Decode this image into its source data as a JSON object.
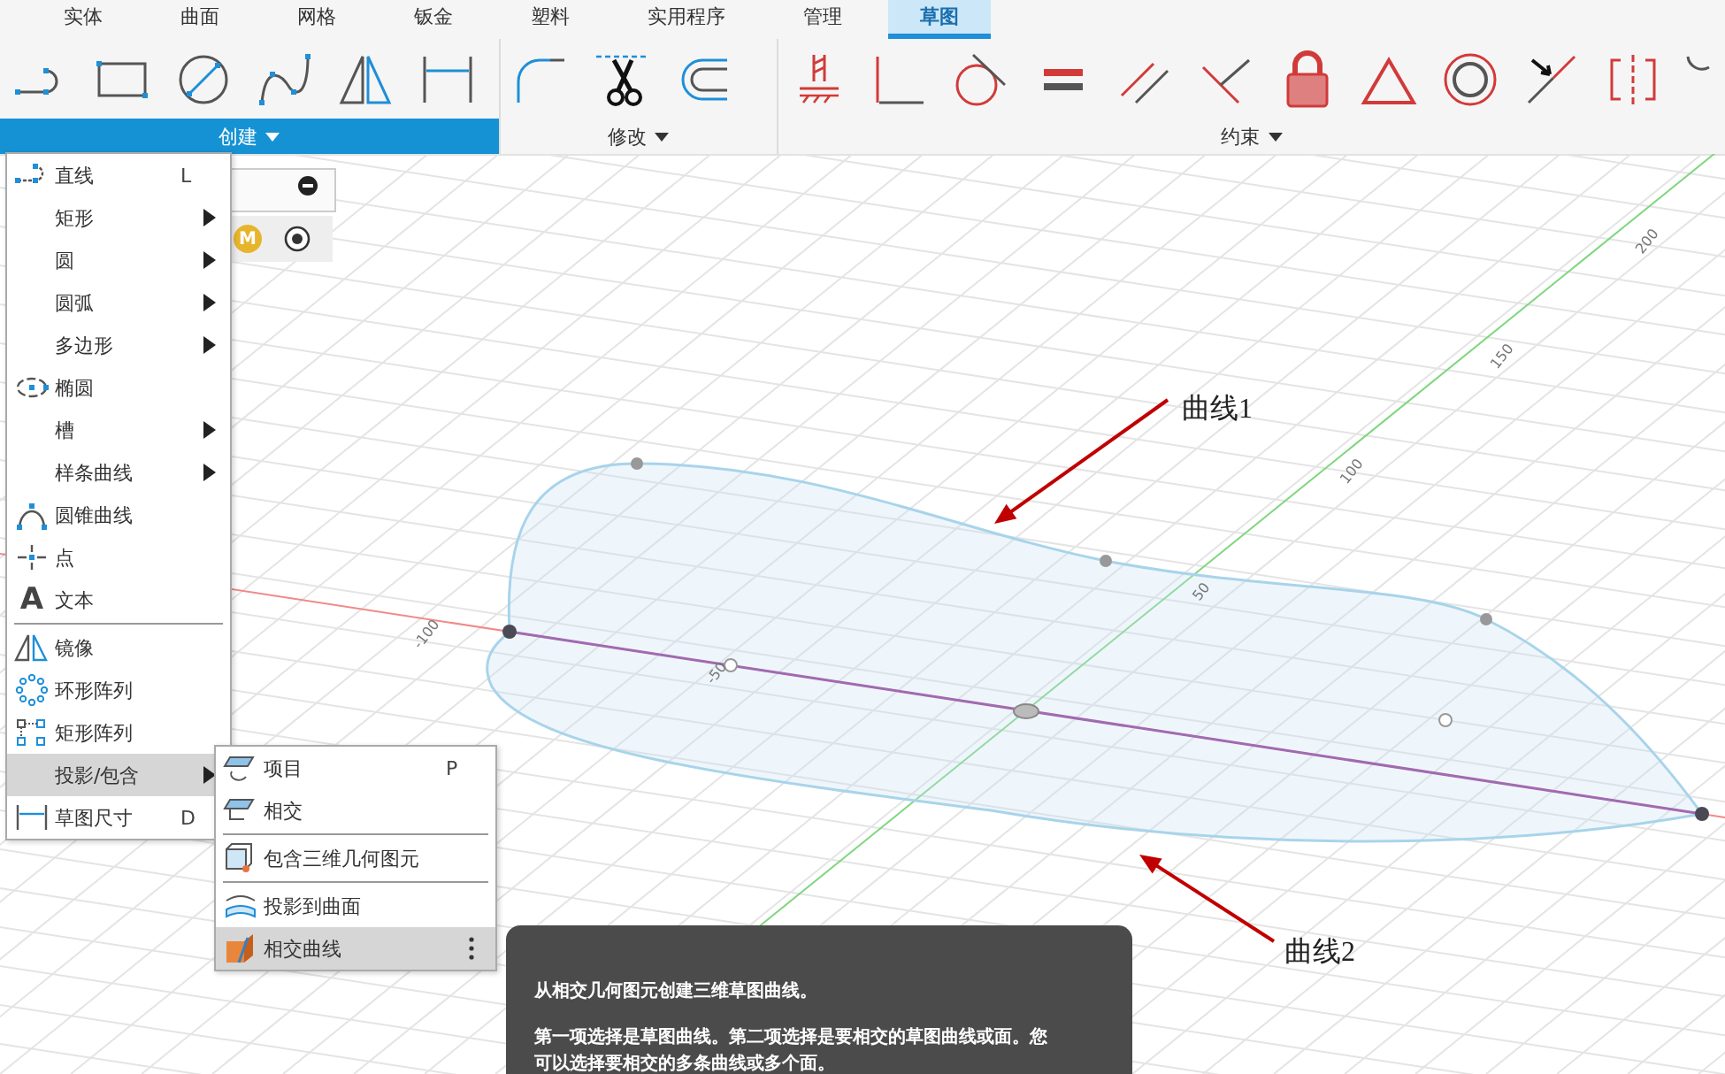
{
  "tabs": [
    {
      "label": "实体",
      "selected": false
    },
    {
      "label": "曲面",
      "selected": false
    },
    {
      "label": "网格",
      "selected": false
    },
    {
      "label": "钣金",
      "selected": false
    },
    {
      "label": "塑料",
      "selected": false
    },
    {
      "label": "实用程序",
      "selected": false
    },
    {
      "label": "管理",
      "selected": false
    },
    {
      "label": "草图",
      "selected": true
    }
  ],
  "ribbon_groups": [
    {
      "label": "创建",
      "selected": true
    },
    {
      "label": "修改",
      "selected": false
    },
    {
      "label": "约束",
      "selected": false
    }
  ],
  "hidden_panel": {
    "badge": "M"
  },
  "create_menu": {
    "sections": [
      [
        {
          "label": "直线",
          "shortcut": "L",
          "submenu": false,
          "selected": false
        },
        {
          "label": "矩形",
          "submenu": true,
          "selected": false
        },
        {
          "label": "圆",
          "submenu": true,
          "selected": false
        },
        {
          "label": "圆弧",
          "submenu": true,
          "selected": false
        },
        {
          "label": "多边形",
          "submenu": true,
          "selected": false
        },
        {
          "label": "椭圆",
          "submenu": false,
          "selected": false
        },
        {
          "label": "槽",
          "submenu": true,
          "selected": false
        },
        {
          "label": "样条曲线",
          "submenu": true,
          "selected": false
        },
        {
          "label": "圆锥曲线",
          "submenu": false,
          "selected": false
        },
        {
          "label": "点",
          "submenu": false,
          "selected": false
        },
        {
          "label": "文本",
          "glyph": "A",
          "submenu": false,
          "selected": false
        }
      ],
      [
        {
          "label": "镜像",
          "submenu": false,
          "selected": false
        },
        {
          "label": "环形阵列",
          "submenu": false,
          "selected": false
        },
        {
          "label": "矩形阵列",
          "submenu": false,
          "selected": false
        },
        {
          "label": "投影/包含",
          "submenu": true,
          "selected": true
        },
        {
          "label": "草图尺寸",
          "shortcut": "D",
          "submenu": false,
          "selected": false
        }
      ]
    ]
  },
  "projection_submenu": {
    "sections": [
      [
        {
          "label": "项目",
          "shortcut": "P",
          "selected": false,
          "more": false
        },
        {
          "label": "相交",
          "selected": false,
          "more": false
        }
      ],
      [
        {
          "label": "包含三维几何图元",
          "selected": false,
          "more": false
        }
      ],
      [
        {
          "label": "投影到曲面",
          "selected": false,
          "more": false
        },
        {
          "label": "相交曲线",
          "selected": true,
          "more": true
        }
      ]
    ]
  },
  "tooltip": {
    "title": "从相交几何图元创建三维草图曲线。",
    "body": "第一项选择是草图曲线。第二项选择是要相交的草图曲线或面。您可以选择要相交的多条曲线或多个面。"
  },
  "viewport": {
    "axis_labels": [
      "-100",
      "-50",
      "50",
      "100",
      "150",
      "200"
    ],
    "annotations": [
      {
        "label": "曲线1"
      },
      {
        "label": "曲线2"
      }
    ]
  }
}
